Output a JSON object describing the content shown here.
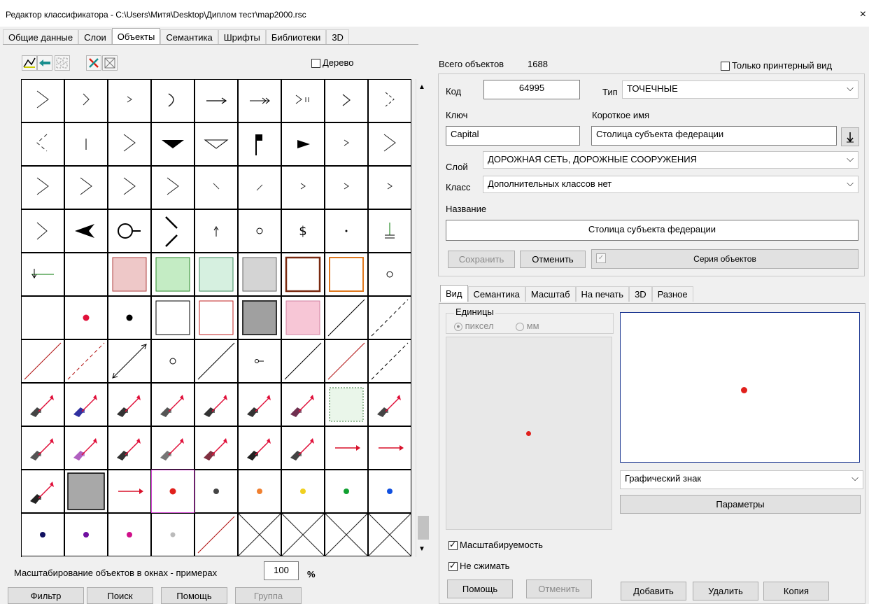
{
  "window": {
    "title": "Редактор классификатора - C:\\Users\\Митя\\Desktop\\Диплом тест\\map2000.rsc",
    "close_glyph": "×"
  },
  "main_tabs": [
    "Общие данные",
    "Слои",
    "Объекты",
    "Семантика",
    "Шрифты",
    "Библиотеки",
    "3D"
  ],
  "main_tabs_active": 2,
  "toolbar": {
    "tree_label": "Дерево",
    "tree_checked": false
  },
  "grid": {
    "cells": [
      "chev-v",
      "chev-v-small",
      "chev-tiny",
      "chev-round",
      "arrow",
      "arrow-double",
      "chev-dots",
      "chev-small",
      "chev-v-sp",
      "chev-left",
      "bar-v",
      "chev-v",
      "tri-fill-down",
      "tri-outline-down",
      "flag",
      "tri-fill-right",
      "chev-tiny",
      "chev-v",
      "chev-v",
      "chev-v",
      "chev-v",
      "chev-v",
      "tick-left",
      "tick-right",
      "chev-tiny",
      "chev-tiny",
      "chev-tiny",
      "chev-big",
      "arrow-left-fill",
      "circle-line",
      "diag-cross",
      "arrow-up",
      "circle-small",
      "dollar",
      "dot-small",
      "ground",
      "arrow-left-line",
      "empty",
      "sq-pink",
      "sq-green",
      "sq-lightgreen",
      "sq-gray",
      "sq-brown",
      "sq-orange",
      "circle-small",
      "empty",
      "dot-red",
      "dot-black",
      "sq-outline-black",
      "sq-outline-red",
      "sq-darkgray",
      "sq-pinkfill",
      "diag-line",
      "diag-dash",
      "diag-red",
      "diag-red-dash",
      "diag-arrow",
      "circle-small",
      "diag-line",
      "circle-line-small",
      "diag-line",
      "diag-red",
      "diag-dash",
      "pic1",
      "pic2",
      "pic3",
      "pic4",
      "pic5",
      "pic6",
      "pic7",
      "sq-dotted-green",
      "pic8",
      "pic9",
      "pic10",
      "pic11",
      "pic12",
      "pic13",
      "pic14",
      "pic15",
      "arrow-red",
      "arrow-red",
      "pic16",
      "sq-gray-big",
      "arrow-red",
      "dot-red-selected",
      "dot-dark",
      "dot-orange",
      "dot-yellow",
      "dot-green",
      "dot-blue",
      "dot-navy",
      "dot-purple",
      "dot-magenta",
      "dot-silver",
      "diag-red",
      "cross",
      "cross",
      "cross",
      "cross"
    ]
  },
  "bottom_left": {
    "scale_label": "Масштабирование объектов в окнах - примерах",
    "scale_value": "100",
    "scale_unit": "%",
    "buttons": [
      "Фильтр",
      "Поиск",
      "Помощь",
      "Группа"
    ]
  },
  "info": {
    "total_label": "Всего объектов",
    "total_value": "1688",
    "print_only_label": "Только принтерный вид",
    "code_label": "Код",
    "code_value": "64995",
    "type_label": "Тип",
    "type_value": "ТОЧЕЧНЫЕ",
    "key_label": "Ключ",
    "key_value": "Capital",
    "short_name_label": "Короткое имя",
    "short_name_value": "Столица субъекта федерации",
    "layer_label": "Слой",
    "layer_value": "ДОРОЖНАЯ СЕТЬ, ДОРОЖНЫЕ СООРУЖЕНИЯ",
    "class_label": "Класс",
    "class_value": "Дополнительных классов нет",
    "name_label": "Название",
    "name_value": "Столица субъекта федерации",
    "save_btn": "Сохранить",
    "cancel_btn": "Отменить",
    "series_btn": "Серия объектов"
  },
  "view_tabs": [
    "Вид",
    "Семантика",
    "Масштаб",
    "На печать",
    "3D",
    "Разное"
  ],
  "view_tabs_active": 0,
  "view": {
    "units_label": "Единицы",
    "unit_pixel": "пиксел",
    "unit_mm": "мм",
    "sign_select": "Графический знак",
    "params_btn": "Параметры",
    "scalable_label": "Масштабируемость",
    "no_compress_label": "Не сжимать",
    "help_btn": "Помощь",
    "cancel_btn": "Отменить",
    "add_btn": "Добавить",
    "delete_btn": "Удалить",
    "copy_btn": "Копия"
  },
  "colors": {
    "accent_border": "#1f3a93",
    "preview_dot": "#e0201c"
  }
}
